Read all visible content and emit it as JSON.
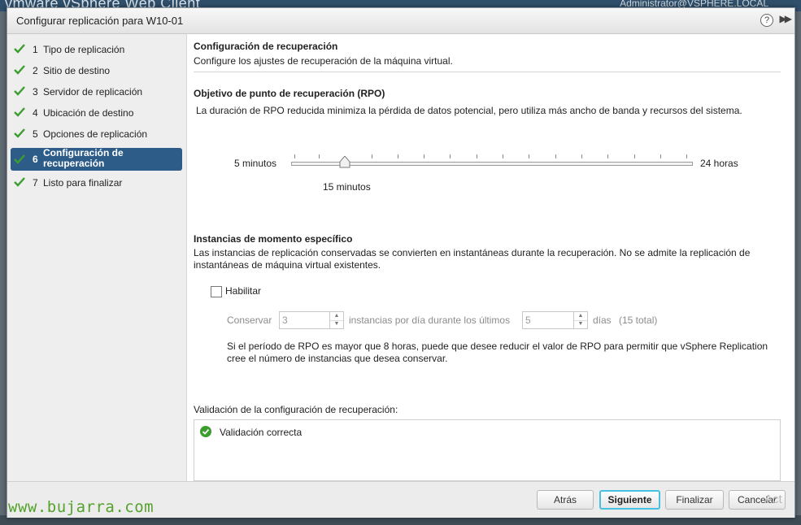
{
  "background": {
    "brand": "vmware vSphere Web Client",
    "user": "Administrator@VSPHERE.LOCAL"
  },
  "dialog": {
    "title": "Configurar replicación para W10-01",
    "help_icon": "?",
    "expand_icon": "▶▶"
  },
  "nav": {
    "items": [
      {
        "num": "1",
        "label": "Tipo de replicación",
        "done": true
      },
      {
        "num": "2",
        "label": "Sitio de destino",
        "done": true
      },
      {
        "num": "3",
        "label": "Servidor de replicación",
        "done": true
      },
      {
        "num": "4",
        "label": "Ubicación de destino",
        "done": true
      },
      {
        "num": "5",
        "label": "Opciones de replicación",
        "done": true
      },
      {
        "num": "6",
        "label": "Configuración de recuperación",
        "done": true,
        "active": true
      },
      {
        "num": "7",
        "label": "Listo para finalizar",
        "done": true
      }
    ]
  },
  "content": {
    "title": "Configuración de recuperación",
    "subtitle": "Configure los ajustes de recuperación de la máquina virtual.",
    "rpo": {
      "heading": "Objetivo de punto de recuperación (RPO)",
      "description": "La duración de RPO reducida minimiza la pérdida de datos potencial, pero utiliza más ancho de banda y recursos del sistema.",
      "min_label": "5 minutos",
      "max_label": "24 horas",
      "value_label": "15 minutos"
    },
    "pit": {
      "heading": "Instancias de momento específico",
      "description": "Las instancias de replicación conservadas se convierten en instantáneas durante la recuperación. No se admite la replicación de instantáneas de máquina virtual existentes.",
      "enable_label": "Habilitar",
      "enabled": false,
      "keep_label": "Conservar",
      "instances_value": "3",
      "per_day_label": "instancias por día durante los últimos",
      "days_value": "5",
      "days_label": "días",
      "total_label": "(15 total)",
      "note": "Si el período de RPO es mayor que 8 horas, puede que desee reducir el valor de RPO para permitir que vSphere Replication cree el número de instancias que desea conservar."
    },
    "validation": {
      "heading": "Validación de la configuración de recuperación:",
      "result": "Validación correcta"
    }
  },
  "footer": {
    "back": "Atrás",
    "next": "Siguiente",
    "finish": "Finalizar",
    "cancel": "Cancelar"
  },
  "watermark": "www.bujarra.com",
  "activation_mark": "Act",
  "colors": {
    "nav_active": "#2c5c87",
    "check_green": "#3c9d2f",
    "primary_focus": "#46c1e0"
  }
}
